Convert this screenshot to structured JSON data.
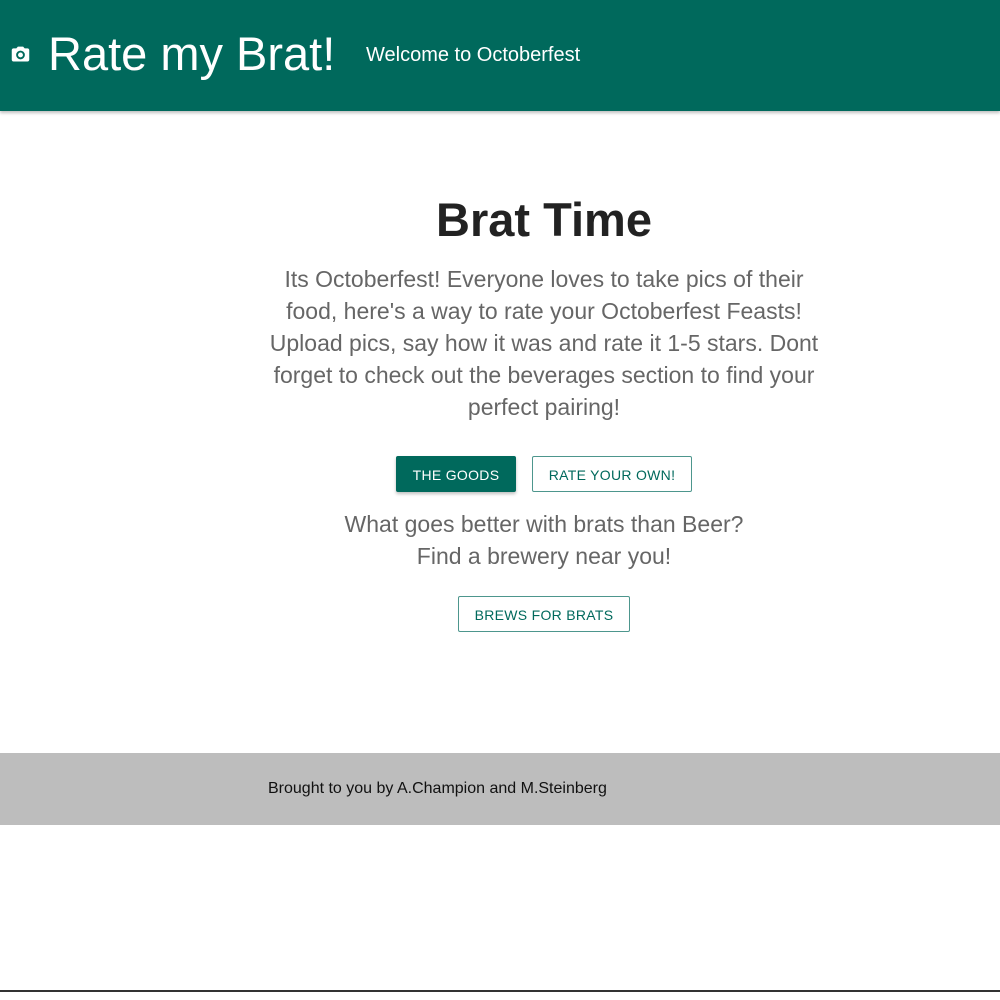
{
  "header": {
    "icon": "camera-icon",
    "title": "Rate my Brat!",
    "subtitle": "Welcome to Octoberfest",
    "background": "#00695c"
  },
  "main": {
    "title": "Brat Time",
    "description": "Its Octoberfest! Everyone loves to take pics of their food, here's a way to rate your Octoberfest Feasts! Upload pics, say how it was and rate it 1-5 stars. Dont forget to check out the beverages section to find your perfect pairing!",
    "buttons": {
      "goods": "THE GOODS",
      "rate_own": "RATE YOUR OWN!"
    },
    "beer_prompt": {
      "line1": "What goes better with brats than Beer?",
      "line2": "Find a brewery near you!"
    },
    "brews_button": "BREWS FOR BRATS"
  },
  "footer": {
    "text": "Brought to you by A.Champion and M.Steinberg",
    "background": "#bdbdbd"
  }
}
